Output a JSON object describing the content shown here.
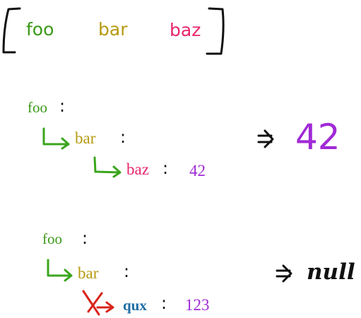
{
  "colors": {
    "foo": "#3a9a18",
    "bar": "#b59a10",
    "baz": "#e8246c",
    "qux": "#1e6ea6",
    "number": "#a02ad6",
    "arrow_ok": "#3aa51c",
    "arrow_broken": "#d9241a",
    "ink": "#111111"
  },
  "path_list": {
    "items": [
      "foo",
      "bar",
      "baz"
    ]
  },
  "example_found": {
    "key1": "foo",
    "key2": "bar",
    "key3": "baz",
    "value": "42",
    "result": "42"
  },
  "example_missing": {
    "key1": "foo",
    "key2": "bar",
    "key3": "qux",
    "value": "123",
    "result": "null"
  },
  "icons": {
    "child_arrow": "hooked-right-arrow-icon",
    "broken_arrow": "crossed-hooked-arrow-icon",
    "implies": "double-arrow-implies-icon",
    "bracket": "bracket-icon"
  }
}
